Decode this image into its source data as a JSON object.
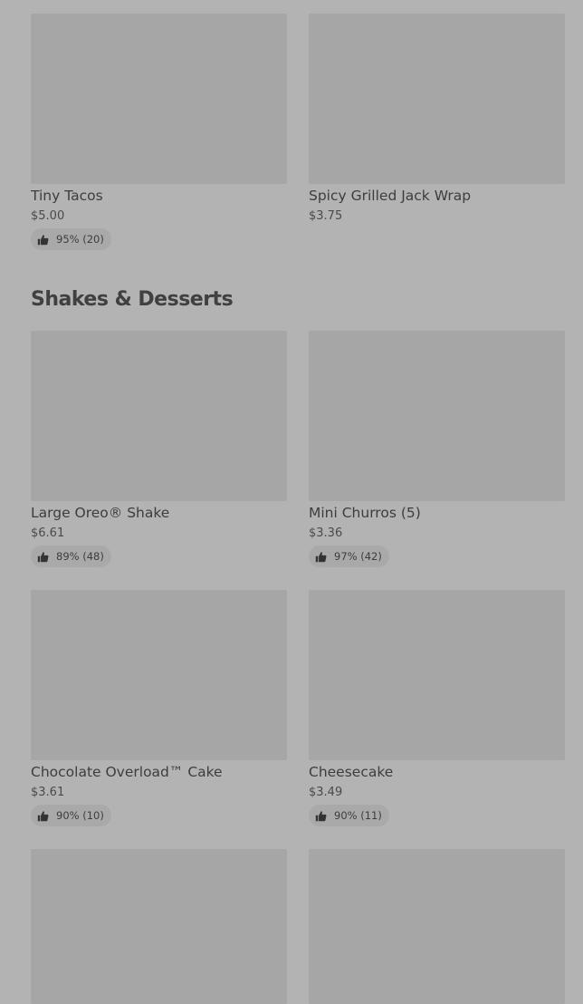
{
  "top_items": [
    {
      "name": "Tiny Tacos",
      "price": "$5.00",
      "rating": "95% (20)",
      "has_rating": true
    },
    {
      "name": "Spicy Grilled Jack Wrap",
      "price": "$3.75",
      "rating": "",
      "has_rating": false
    }
  ],
  "section": {
    "title": "Shakes & Desserts"
  },
  "dessert_items": [
    {
      "name": "Large Oreo® Shake",
      "price": "$6.61",
      "rating": "89% (48)"
    },
    {
      "name": "Mini Churros (5)",
      "price": "$3.36",
      "rating": "97% (42)"
    },
    {
      "name": "Chocolate Overload™ Cake",
      "price": "$3.61",
      "rating": "90% (10)"
    },
    {
      "name": "Cheesecake",
      "price": "$3.49",
      "rating": "90% (11)"
    }
  ],
  "icons": {
    "rating": "thumbs-up-icon"
  }
}
